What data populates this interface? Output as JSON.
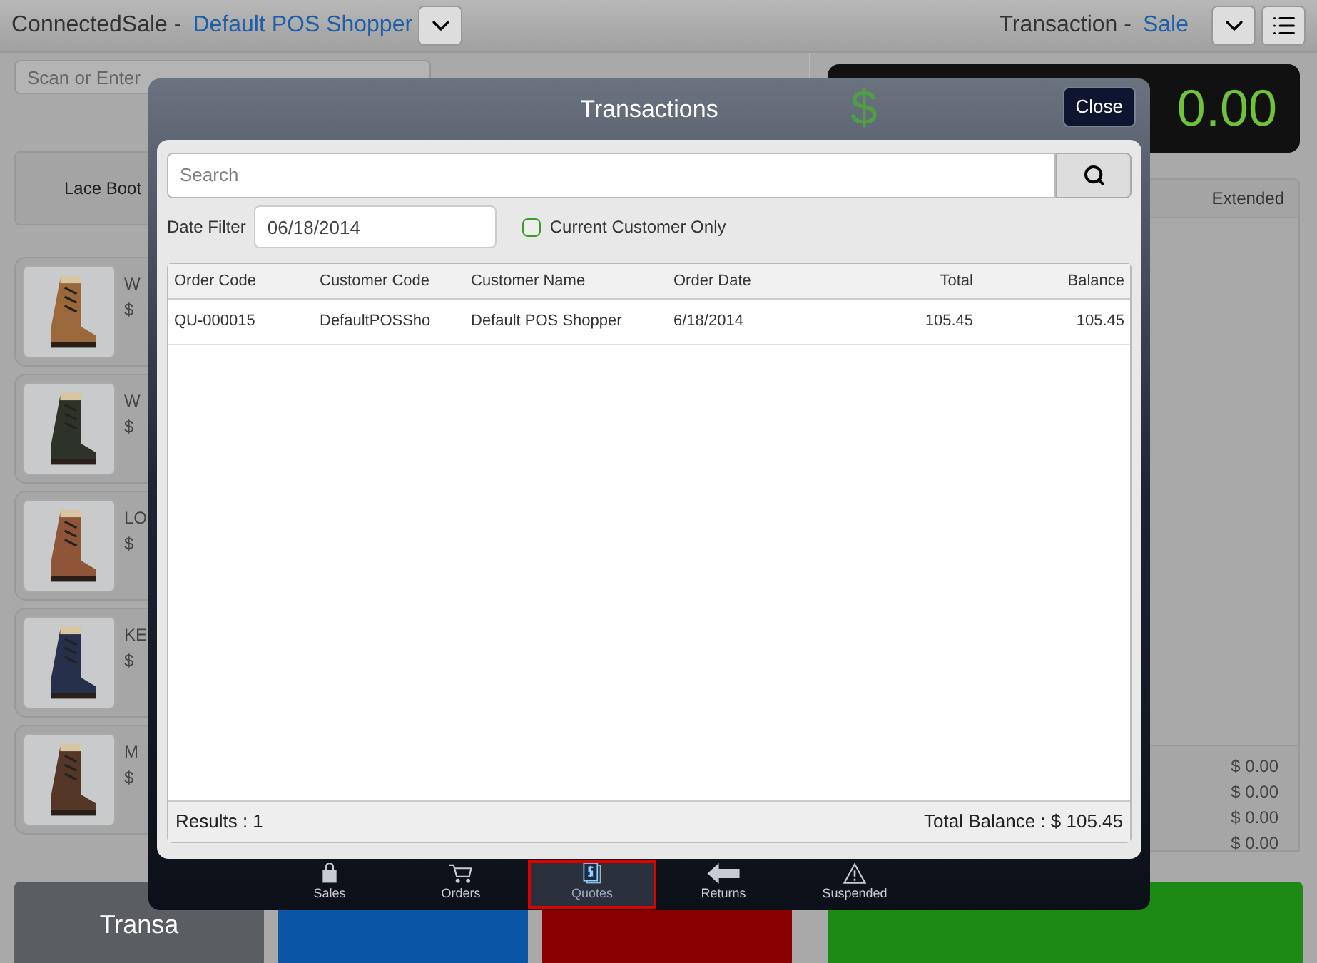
{
  "header": {
    "app": "ConnectedSale -",
    "customer": "Default POS Shopper",
    "transaction_label": "Transaction -",
    "transaction_type": "Sale"
  },
  "scan": {
    "placeholder": "Scan or Enter"
  },
  "category": "Lace Boot",
  "products": [
    {
      "name": "W",
      "price": "$"
    },
    {
      "name": "W",
      "price": "$"
    },
    {
      "name": "LO",
      "price": "$"
    },
    {
      "name": "KE",
      "price": "$"
    },
    {
      "name": "M",
      "price": "$"
    }
  ],
  "total_display": {
    "currency": "$",
    "amount": "0.00"
  },
  "cart": {
    "column": "Extended",
    "totals": [
      "$ 0.00",
      "$ 0.00",
      "$ 0.00",
      "$ 0.00"
    ]
  },
  "bottom_buttons": [
    {
      "label": "Transa",
      "color": "#5a5e63"
    },
    {
      "color": "#0b55a6"
    },
    {
      "color": "#8a0000"
    },
    {
      "color": "#1e8a16"
    }
  ],
  "modal": {
    "title": "Transactions",
    "close": "Close",
    "search": {
      "placeholder": "Search"
    },
    "date_filter": {
      "label": "Date Filter",
      "value": "06/18/2014"
    },
    "current_customer_only": {
      "label": "Current Customer Only",
      "checked": false
    },
    "table": {
      "columns": [
        "Order Code",
        "Customer Code",
        "Customer Name",
        "Order Date",
        "Total",
        "Balance"
      ],
      "rows": [
        [
          "QU-000015",
          "DefaultPOSSho",
          "Default POS Shopper",
          "6/18/2014",
          "105.45",
          "105.45"
        ]
      ]
    },
    "results": "Results : 1",
    "total_balance": "Total Balance : $ 105.45",
    "tabs": [
      {
        "label": "Sales",
        "kind": "bag",
        "selected": false
      },
      {
        "label": "Orders",
        "kind": "cart",
        "selected": false
      },
      {
        "label": "Quotes",
        "kind": "quote",
        "selected": true
      },
      {
        "label": "Returns",
        "kind": "arrow",
        "selected": false
      },
      {
        "label": "Suspended",
        "kind": "warning",
        "selected": false
      }
    ]
  }
}
